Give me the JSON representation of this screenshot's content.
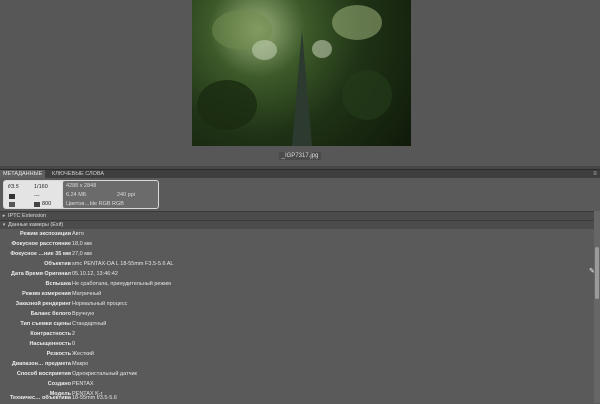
{
  "preview": {
    "filename": "_IGP7317.jpg"
  },
  "tabs": [
    {
      "label": "МЕТАДАННЫЕ"
    },
    {
      "label": "КЛЮЧЕВЫЕ СЛОВА"
    }
  ],
  "summary": {
    "aperture": "f/3.5",
    "shutter": "1/160",
    "metering_value": "---",
    "iso_value": "800",
    "dimensions": "4288 x 2848",
    "file_size": "6.24 МБ",
    "resolution": "240 ppi",
    "color_space": "Цветов…ble RGB RGB"
  },
  "sections": {
    "iptc_extension": "IPTC Extension",
    "camera_data": "Данные камеры (Exif)"
  },
  "exif_rows": [
    {
      "label": "Режим экспозиции",
      "value": "Авто"
    },
    {
      "label": "Фокусное расстояние",
      "value": "18,0 мм"
    },
    {
      "label": "Фокусное …ние 35 мм",
      "value": "27,0 мм"
    },
    {
      "label": "Объектив",
      "value": "smc PENTAX-DA L 18-55mm F3.5-5.6 AL"
    },
    {
      "label": "Дата Время Оригинал",
      "value": "05.10.12, 13:46:42"
    },
    {
      "label": "Вспышка",
      "value": "Не сработала, принудительный режим"
    },
    {
      "label": "Режим измерения",
      "value": "Матричный"
    },
    {
      "label": "Заказной рендеринг",
      "value": "Нормальный процесс"
    },
    {
      "label": "Баланс белого",
      "value": "Вручную"
    },
    {
      "label": "Тип съемки сцены",
      "value": "Стандартный"
    },
    {
      "label": "Контрастность",
      "value": "2"
    },
    {
      "label": "Насыщенность",
      "value": "0"
    },
    {
      "label": "Резкость",
      "value": "Жесткий"
    },
    {
      "label": "Диапазон… предмета",
      "value": "Макро"
    },
    {
      "label": "Способ восприятия",
      "value": "Однокристальный датчик"
    },
    {
      "label": "Создано",
      "value": "PENTAX"
    },
    {
      "label": "Модель",
      "value": "PENTAX K-r"
    },
    {
      "label": "Техничес… объектива",
      "value": "18-55mm f/3.5-5.6"
    }
  ]
}
